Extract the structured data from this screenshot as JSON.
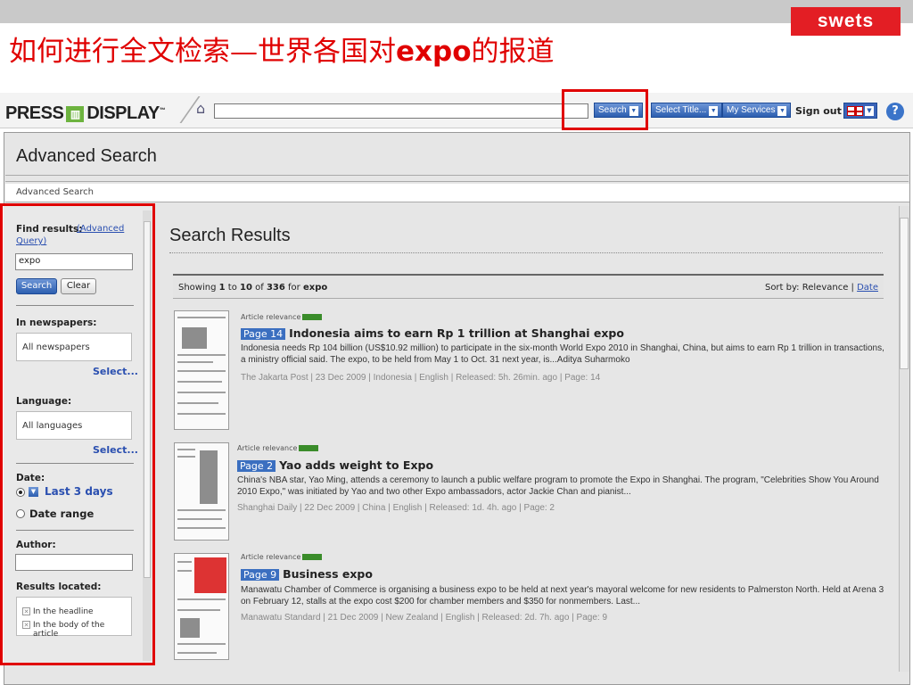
{
  "slide": {
    "title_cn_prefix": "如何进行全文检索—世界各国对",
    "title_bold": "expo",
    "title_cn_suffix": "的报道",
    "brand": "swets"
  },
  "header": {
    "logo_left": "PRESS",
    "logo_right": "DISPLAY",
    "logo_tm": "™",
    "search_value": "",
    "search_button": "Search",
    "select_title": "Select Title...",
    "my_services": "My Services",
    "sign_out": "Sign out",
    "help": "?"
  },
  "advanced": {
    "title": "Advanced Search",
    "breadcrumb": "Advanced Search"
  },
  "sidebar": {
    "find_label": "Find results:",
    "adv_query_1": "(Advanced",
    "adv_query_2": "Query)",
    "query_value": "expo",
    "search_btn": "Search",
    "clear_btn": "Clear",
    "newspapers_label": "In newspapers:",
    "newspapers_value": "All newspapers",
    "newspapers_select": "Select...",
    "language_label": "Language:",
    "language_value": "All languages",
    "language_select": "Select...",
    "date_label": "Date:",
    "date_option_1": "Last 3 days",
    "date_option_2": "Date range",
    "author_label": "Author:",
    "author_value": "",
    "located_label": "Results located:",
    "located_1": "In the headline",
    "located_2": "In the body of the article"
  },
  "results": {
    "title": "Search Results",
    "showing_prefix": "Showing",
    "from": "1",
    "to_word": "to",
    "to": "10",
    "of_word": "of",
    "total": "336",
    "for_word": "for",
    "query": "expo",
    "sort_prefix": "Sort by: Relevance |",
    "sort_date": "Date",
    "relevance_label": "Article relevance",
    "items": [
      {
        "page": "Page 14",
        "title": "Indonesia aims to earn Rp 1 trillion at Shanghai expo",
        "snippet": "Indonesia needs Rp 104 billion (US$10.92 million) to participate in the six-month World Expo 2010 in Shanghai, China, but aims to earn Rp 1 trillion in transactions, a ministry official said. The expo, to be held from May 1 to Oct. 31 next year, is...Aditya Suharmoko",
        "meta": "The Jakarta Post | 23 Dec 2009 | Indonesia | English | Released: 5h. 26min. ago | Page: 14"
      },
      {
        "page": "Page 2",
        "title": "Yao adds weight to Expo",
        "snippet": "China's NBA star, Yao Ming, attends a ceremony to launch a public welfare program to promote the Expo in Shanghai. The program, \"Celebrities Show You Around 2010 Expo,\" was initiated by Yao and two other Expo ambassadors, actor Jackie Chan and pianist...",
        "meta": "Shanghai Daily | 22 Dec 2009 | China | English | Released: 1d. 4h. ago | Page: 2"
      },
      {
        "page": "Page 9",
        "title": "Business expo",
        "snippet": "Manawatu Chamber of Commerce is organising a business expo to be held at next year's mayoral welcome for new residents to Palmerston North. Held at Arena 3 on February 12, stalls at the expo cost $200 for chamber members and $350 for nonmembers. Last...",
        "meta": "Manawatu Standard | 21 Dec 2009 | New Zealand | English | Released: 2d. 7h. ago | Page: 9"
      }
    ]
  },
  "colors": {
    "highlight_red": "#e00000",
    "brand_red": "#e31e24",
    "link_blue": "#2a4fb0",
    "button_blue": "#2d5fb0",
    "relevance_green": "#3a8c2a"
  }
}
